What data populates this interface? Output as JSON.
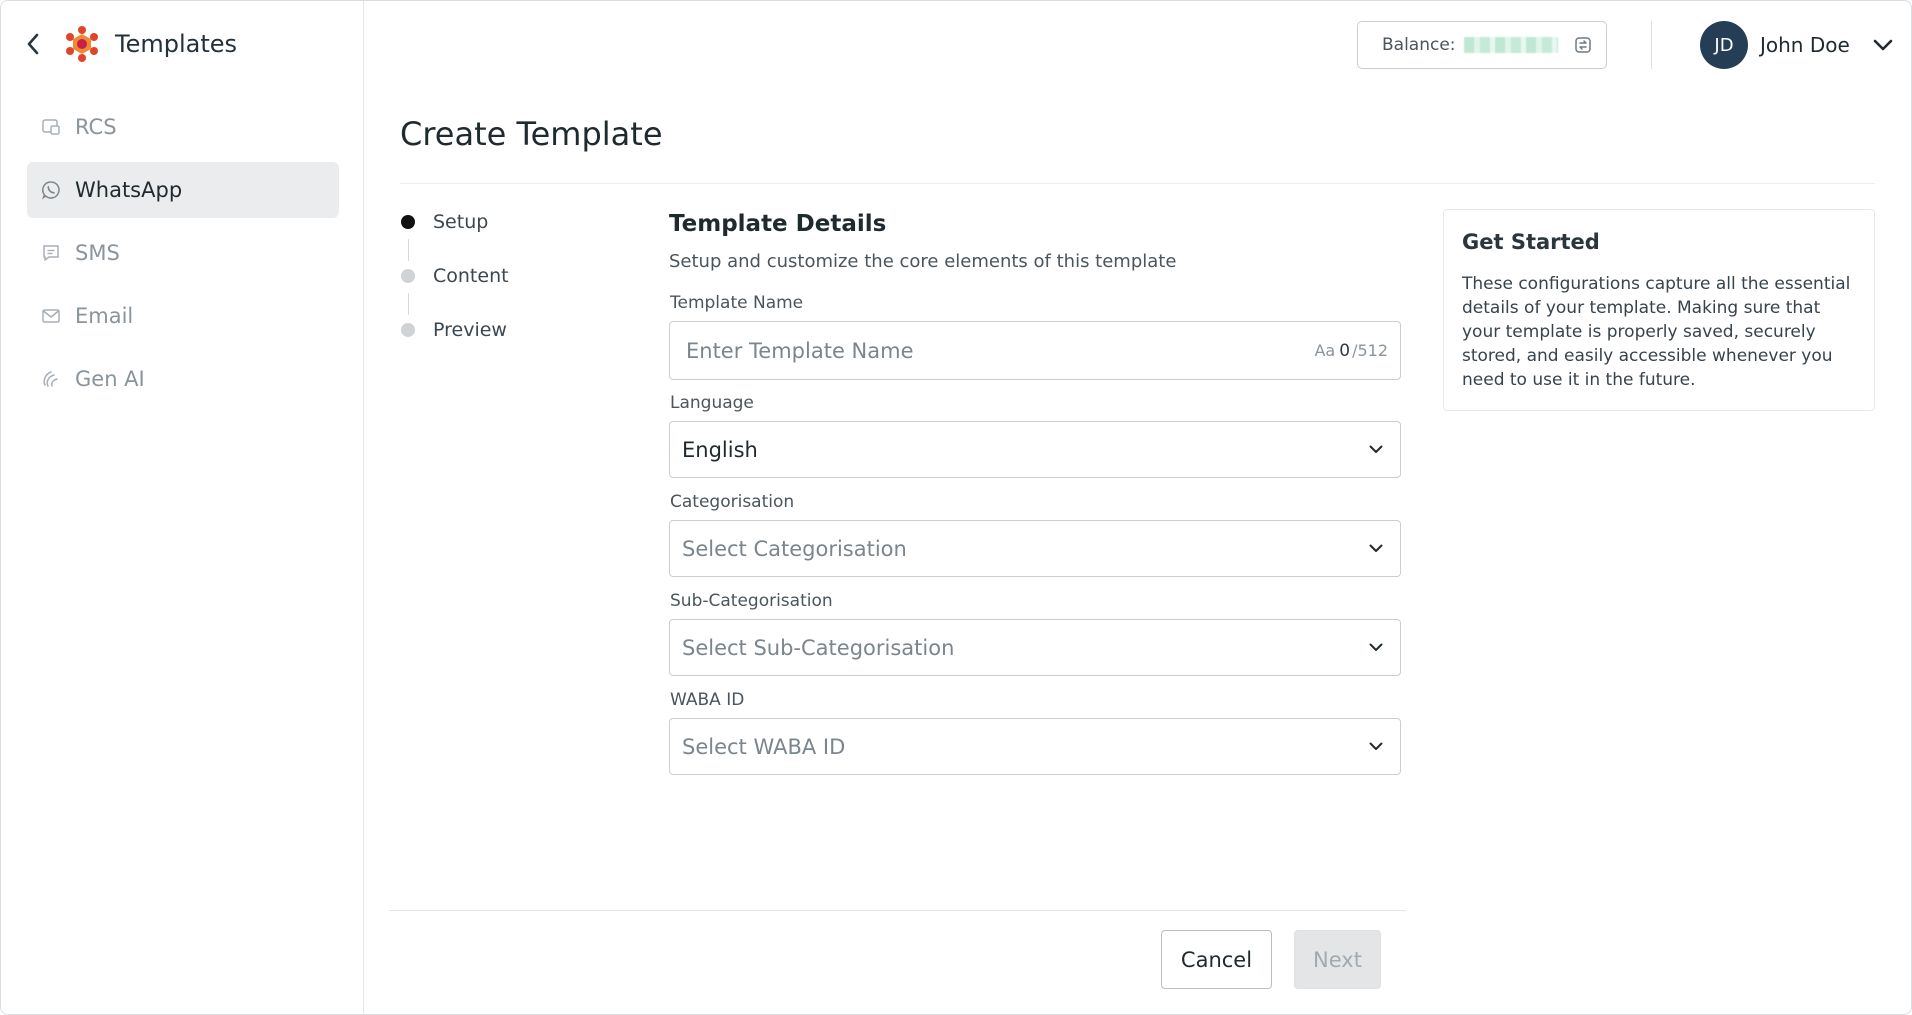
{
  "sidebar": {
    "title": "Templates",
    "items": [
      {
        "label": "RCS",
        "icon": "rcs-icon"
      },
      {
        "label": "WhatsApp",
        "icon": "whatsapp-icon",
        "active": true
      },
      {
        "label": "SMS",
        "icon": "sms-icon"
      },
      {
        "label": "Email",
        "icon": "email-icon"
      },
      {
        "label": "Gen AI",
        "icon": "gen-ai-icon"
      }
    ]
  },
  "header": {
    "balance_label": "Balance:",
    "user_initials": "JD",
    "user_name": "John Doe"
  },
  "page": {
    "title": "Create Template"
  },
  "stepper": {
    "steps": [
      {
        "label": "Setup",
        "current": true
      },
      {
        "label": "Content",
        "current": false
      },
      {
        "label": "Preview",
        "current": false
      }
    ]
  },
  "form": {
    "heading": "Template Details",
    "subheading": "Setup and customize the core elements of this template",
    "template_name": {
      "label": "Template Name",
      "placeholder": "Enter Template Name",
      "counter_prefix": "Aa",
      "count": "0",
      "max": "/512"
    },
    "language": {
      "label": "Language",
      "value": "English"
    },
    "categorisation": {
      "label": "Categorisation",
      "placeholder": "Select Categorisation"
    },
    "sub_categorisation": {
      "label": "Sub-Categorisation",
      "placeholder": "Select Sub-Categorisation"
    },
    "waba_id": {
      "label": "WABA ID",
      "placeholder": "Select WABA ID"
    }
  },
  "info": {
    "title": "Get Started",
    "text": "These configurations capture all the essential details of your template. Making sure that your template is properly saved, securely stored, and easily accessible whenever you need to use it in the future."
  },
  "footer": {
    "cancel_label": "Cancel",
    "next_label": "Next"
  },
  "colors": {
    "accent": "#e0452b",
    "avatar_bg": "#263d56",
    "active_nav_bg": "#ebeced",
    "disabled_button_bg": "#e3e5e7"
  }
}
